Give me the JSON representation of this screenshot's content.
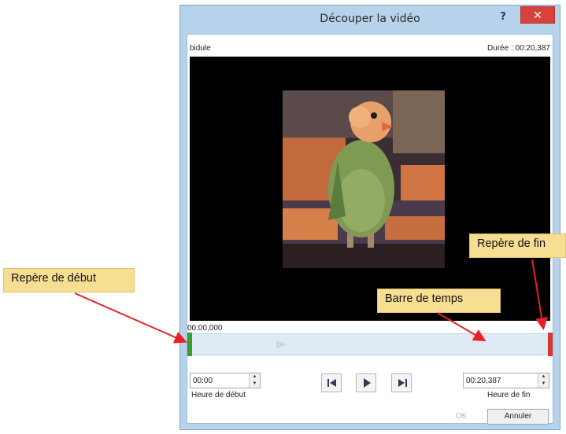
{
  "dialog": {
    "title": "Découper la vidéo",
    "help_label": "?",
    "close_label": "✕",
    "video_name": "bidule",
    "duration_text": "Durée : 00:20,387",
    "time_readout": "00:00,000",
    "start_time": {
      "value": "00:00",
      "label": "Heure de début"
    },
    "end_time": {
      "value": "00:20,387",
      "label": "Heure de fin"
    },
    "ok_label": "OK",
    "cancel_label": "Annuler"
  },
  "controls": {
    "icons": [
      "previous-frame-icon",
      "play-icon",
      "next-frame-icon"
    ]
  },
  "callouts": {
    "start_marker": "Repère de début",
    "timeline": "Barre de temps",
    "end_marker": "Repère de fin"
  },
  "colors": {
    "close_red": "#d9423a",
    "start_marker_green": "#3a9c32",
    "end_marker_red": "#d9362d",
    "callout_bg": "#f6de93",
    "arrow_red": "#e8202a"
  }
}
